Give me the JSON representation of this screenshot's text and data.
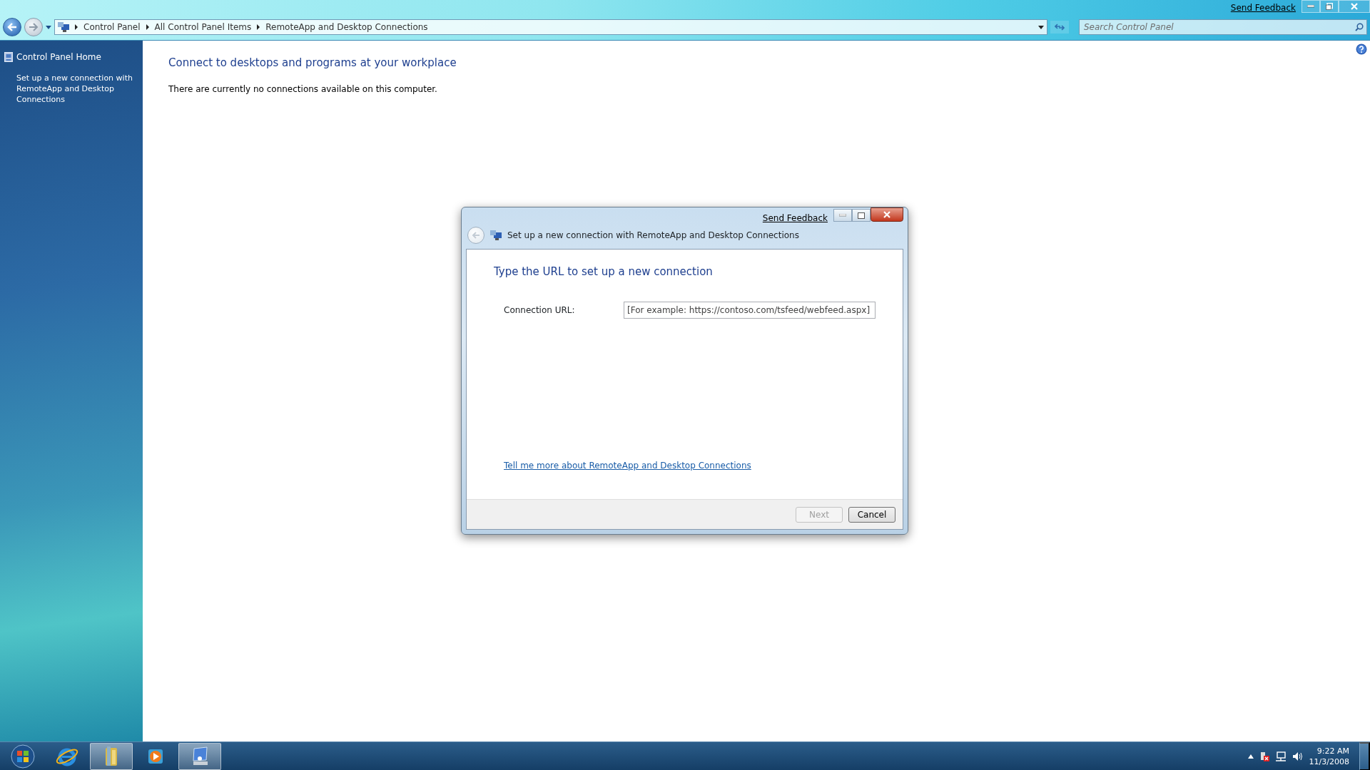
{
  "window": {
    "send_feedback": "Send Feedback"
  },
  "address_bar": {
    "crumbs": [
      "Control Panel",
      "All Control Panel Items",
      "RemoteApp and Desktop Connections"
    ]
  },
  "search": {
    "placeholder": "Search Control Panel"
  },
  "sidebar": {
    "items": [
      {
        "label": "Control Panel Home",
        "kind": "home"
      },
      {
        "label": "Set up a new connection with RemoteApp and Desktop Connections",
        "kind": "task"
      }
    ]
  },
  "content": {
    "heading": "Connect to desktops and programs at your workplace",
    "message": "There are currently no connections available on this computer."
  },
  "dialog": {
    "send_feedback": "Send Feedback",
    "title": "Set up a new connection with RemoteApp and Desktop Connections",
    "back_disabled": true,
    "heading": "Type the URL to set up a new connection",
    "field": {
      "label": "Connection URL:",
      "placeholder": "[For example: https://contoso.com/tsfeed/webfeed.aspx]"
    },
    "link": "Tell me more about RemoteApp and Desktop Connections",
    "buttons": [
      {
        "label": "Next",
        "disabled": true
      },
      {
        "label": "Cancel",
        "disabled": false
      }
    ]
  },
  "taskbar": {
    "items": [
      {
        "kind": "start",
        "active": false
      },
      {
        "kind": "browser",
        "active": false
      },
      {
        "kind": "folder",
        "active": true
      },
      {
        "kind": "media",
        "active": false
      },
      {
        "kind": "remote",
        "active": true
      }
    ],
    "time": "9:22 AM",
    "date": "11/3/2008"
  }
}
